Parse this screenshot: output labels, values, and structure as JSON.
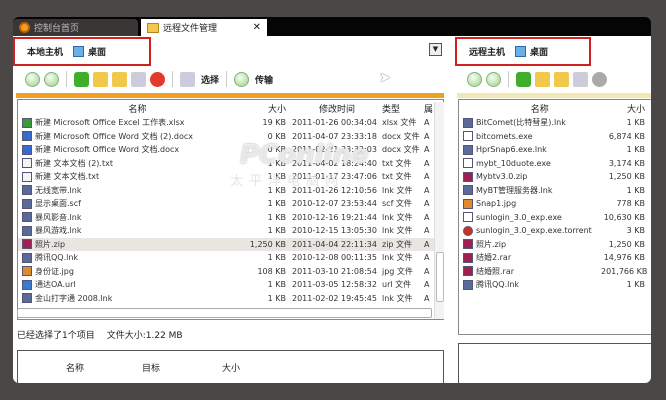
{
  "tabs": [
    {
      "label": "控制台首页",
      "icon": "console-icon"
    },
    {
      "label": "远程文件管理",
      "icon": "folder-icon",
      "close": "✕"
    }
  ],
  "local": {
    "host_label": "本地主机",
    "location": "桌面"
  },
  "remote": {
    "host_label": "远程主机",
    "location": "桌面"
  },
  "toolbar": {
    "select_label": "选择",
    "transfer_label": "传输"
  },
  "left_columns": {
    "name": "名称",
    "size": "大小",
    "modified": "修改时间",
    "type": "类型",
    "attr": "属"
  },
  "left_files": [
    {
      "name": "新建 Microsoft Office Excel 工作表.xlsx",
      "size": "19 KB",
      "modified": "2011-01-26 00:34:04",
      "type": "xlsx 文件",
      "attr": "A",
      "icon": "excel"
    },
    {
      "name": "新建 Microsoft Office Word 文档 (2).docx",
      "size": "0 KB",
      "modified": "2011-04-07 23:33:18",
      "type": "docx 文件",
      "attr": "A",
      "icon": "word"
    },
    {
      "name": "新建 Microsoft Office Word 文档.docx",
      "size": "0 KB",
      "modified": "2011-02-21 23:32:03",
      "type": "docx 文件",
      "attr": "A",
      "icon": "word"
    },
    {
      "name": "新建 文本文档 (2).txt",
      "size": "1 KB",
      "modified": "2011-04-02 18:24:40",
      "type": "txt 文件",
      "attr": "A",
      "icon": "txt"
    },
    {
      "name": "新建 文本文档.txt",
      "size": "1 KB",
      "modified": "2011-01-17 23:47:06",
      "type": "txt 文件",
      "attr": "A",
      "icon": "txt"
    },
    {
      "name": "无线宽带.lnk",
      "size": "1 KB",
      "modified": "2011-01-26 12:10:56",
      "type": "lnk 文件",
      "attr": "A",
      "icon": "lnk"
    },
    {
      "name": "显示桌面.scf",
      "size": "1 KB",
      "modified": "2010-12-07 23:53:44",
      "type": "scf 文件",
      "attr": "A",
      "icon": "lnk"
    },
    {
      "name": "暴风影音.lnk",
      "size": "1 KB",
      "modified": "2010-12-16 19:21:44",
      "type": "lnk 文件",
      "attr": "A",
      "icon": "lnk"
    },
    {
      "name": "暴风游戏.lnk",
      "size": "1 KB",
      "modified": "2010-12-15 13:05:30",
      "type": "lnk 文件",
      "attr": "A",
      "icon": "lnk"
    },
    {
      "name": "照片.zip",
      "size": "1,250 KB",
      "modified": "2011-04-04 22:11:34",
      "type": "zip 文件",
      "attr": "A",
      "icon": "zip",
      "selected": true
    },
    {
      "name": "腾讯QQ.lnk",
      "size": "1 KB",
      "modified": "2010-12-08 00:11:35",
      "type": "lnk 文件",
      "attr": "A",
      "icon": "lnk"
    },
    {
      "name": "身份证.jpg",
      "size": "108 KB",
      "modified": "2011-03-10 21:08:54",
      "type": "jpg 文件",
      "attr": "A",
      "icon": "jpg"
    },
    {
      "name": "通达OA.url",
      "size": "1 KB",
      "modified": "2011-03-05 12:58:32",
      "type": "url 文件",
      "attr": "A",
      "icon": "url"
    },
    {
      "name": "金山打字通 2008.lnk",
      "size": "1 KB",
      "modified": "2011-02-02 19:45:45",
      "type": "lnk 文件",
      "attr": "A",
      "icon": "lnk"
    }
  ],
  "status": {
    "selected": "已经选择了1个项目",
    "filesize": "文件大小:1.22 MB"
  },
  "transfer_columns": {
    "name": "名称",
    "target": "目标",
    "size": "大小"
  },
  "right_columns": {
    "name": "名称",
    "size": "大小"
  },
  "right_files": [
    {
      "name": "BitComet(比特彗星).lnk",
      "size": "1 KB",
      "icon": "lnk"
    },
    {
      "name": "bitcomets.exe",
      "size": "6,874 KB",
      "icon": "exe"
    },
    {
      "name": "HprSnap6.exe.lnk",
      "size": "1 KB",
      "icon": "lnk"
    },
    {
      "name": "mybt_10duote.exe",
      "size": "3,174 KB",
      "icon": "exe"
    },
    {
      "name": "Mybtv3.0.zip",
      "size": "1,250 KB",
      "icon": "zip"
    },
    {
      "name": "MyBT管理服务器.lnk",
      "size": "1 KB",
      "icon": "lnk"
    },
    {
      "name": "Snap1.jpg",
      "size": "778 KB",
      "icon": "jpg"
    },
    {
      "name": "sunlogin_3.0_exp.exe",
      "size": "10,630 KB",
      "icon": "exe"
    },
    {
      "name": "sunlogin_3.0_exp.exe.torrent",
      "size": "3 KB",
      "icon": "torrent"
    },
    {
      "name": "照片.zip",
      "size": "1,250 KB",
      "icon": "zip"
    },
    {
      "name": "结婚2.rar",
      "size": "14,976 KB",
      "icon": "zip"
    },
    {
      "name": "结婚照.rar",
      "size": "201,766 KB",
      "icon": "zip"
    },
    {
      "name": "腾讯QQ.lnk",
      "size": "1 KB",
      "icon": "lnk"
    }
  ],
  "watermark": {
    "brand": "PConline",
    "sub": "太平洋电脑网"
  },
  "colors": {
    "accent": "#f0a020",
    "highlight_box": "#d02020"
  }
}
